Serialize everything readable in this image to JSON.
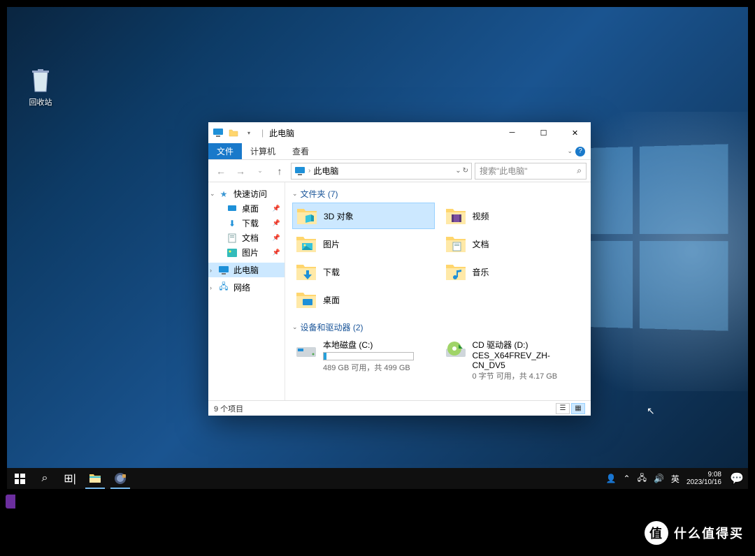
{
  "desktop": {
    "recycle_bin": "回收站"
  },
  "explorer": {
    "title": "此电脑",
    "ribbon": {
      "file": "文件",
      "computer": "计算机",
      "view": "查看"
    },
    "address": {
      "location": "此电脑"
    },
    "search": {
      "placeholder": "搜索\"此电脑\""
    },
    "sidebar": {
      "quick_access": "快速访问",
      "desktop": "桌面",
      "downloads": "下载",
      "documents": "文档",
      "pictures": "图片",
      "this_pc": "此电脑",
      "network": "网络"
    },
    "groups": {
      "folders": {
        "label": "文件夹 (7)",
        "count": 7
      },
      "drives": {
        "label": "设备和驱动器 (2)",
        "count": 2
      }
    },
    "folders": {
      "objects3d": "3D 对象",
      "videos": "视频",
      "pictures": "图片",
      "documents": "文档",
      "downloads": "下载",
      "music": "音乐",
      "desktop": "桌面"
    },
    "drives": {
      "c": {
        "name": "本地磁盘 (C:)",
        "stat": "489 GB 可用，共 499 GB",
        "fill_pct": 3
      },
      "d": {
        "name": "CD 驱动器 (D:)",
        "sub": "CES_X64FREV_ZH-CN_DV5",
        "stat": "0 字节 可用，共 4.17 GB"
      }
    },
    "status": "9 个项目"
  },
  "taskbar": {
    "ime": "英",
    "time": "9:08",
    "date": "2023/10/16"
  },
  "watermark": "什么值得买"
}
